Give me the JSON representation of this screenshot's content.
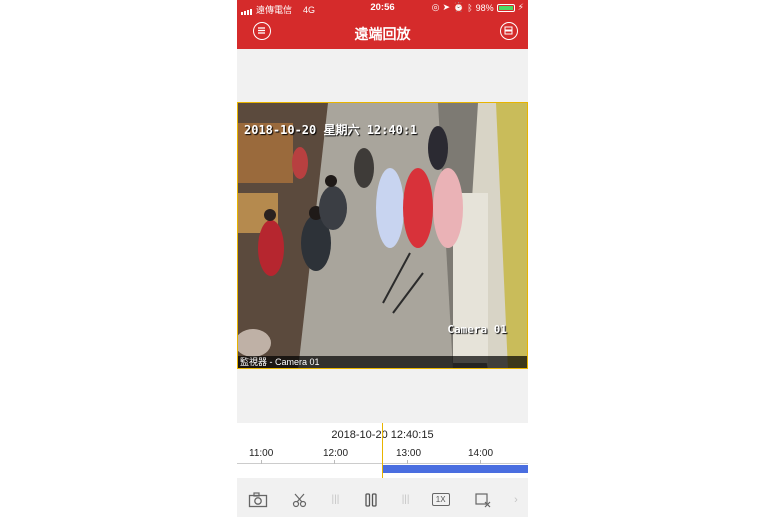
{
  "status_bar": {
    "carrier": "遠傳電信",
    "network": "4G",
    "time": "20:56",
    "battery": "98%"
  },
  "header": {
    "title": "遠端回放",
    "menu_icon": "menu-icon",
    "share_icon": "device-list-icon"
  },
  "video": {
    "timestamp_overlay": "2018-10-20 星期六 12:40:1",
    "camera_overlay": "Camera 01",
    "caption": "監視器 - Camera 01"
  },
  "timeline": {
    "current_datetime": "2018-10-20  12:40:15",
    "ticks": [
      "11:00",
      "12:00",
      "13:00",
      "14:00"
    ],
    "cursor_color": "#e8b400",
    "recording_color": "#4a6ee0"
  },
  "toolbar": {
    "speed_label": "1X",
    "icons": [
      "camera-icon",
      "clip-icon",
      "pause-icon",
      "speed-icon",
      "close-window-icon"
    ]
  },
  "colors": {
    "brand": "#d52b2b",
    "accent": "#e8b400"
  }
}
